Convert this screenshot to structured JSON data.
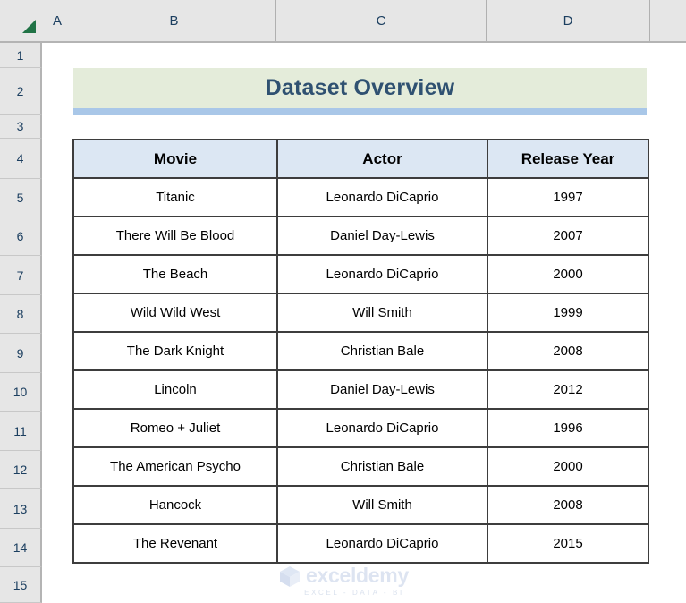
{
  "spreadsheet": {
    "select_all_icon": "select-all-triangle",
    "column_headers": [
      "A",
      "B",
      "C",
      "D"
    ],
    "row_headers": [
      "1",
      "2",
      "3",
      "4",
      "5",
      "6",
      "7",
      "8",
      "9",
      "10",
      "11",
      "12",
      "13",
      "14",
      "15"
    ]
  },
  "title_banner": {
    "text": "Dataset Overview",
    "background_color": "#e4ecda",
    "text_color": "#2f5171",
    "underline_color": "#a9c7e8"
  },
  "table": {
    "header_background": "#dce7f3",
    "border_color": "#3d3d3d",
    "columns": [
      "Movie",
      "Actor",
      "Release Year"
    ],
    "rows": [
      {
        "movie": "Titanic",
        "actor": "Leonardo DiCaprio",
        "year": "1997"
      },
      {
        "movie": "There Will Be Blood",
        "actor": "Daniel Day-Lewis",
        "year": "2007"
      },
      {
        "movie": "The Beach",
        "actor": "Leonardo DiCaprio",
        "year": "2000"
      },
      {
        "movie": "Wild Wild West",
        "actor": "Will Smith",
        "year": "1999"
      },
      {
        "movie": "The Dark Knight",
        "actor": "Christian Bale",
        "year": "2008"
      },
      {
        "movie": "Lincoln",
        "actor": "Daniel Day-Lewis",
        "year": "2012"
      },
      {
        "movie": "Romeo + Juliet",
        "actor": "Leonardo DiCaprio",
        "year": "1996"
      },
      {
        "movie": "The American Psycho",
        "actor": "Christian Bale",
        "year": "2000"
      },
      {
        "movie": "Hancock",
        "actor": "Will Smith",
        "year": "2008"
      },
      {
        "movie": "The Revenant",
        "actor": "Leonardo DiCaprio",
        "year": "2015"
      }
    ]
  },
  "watermark": {
    "name": "exceldemy",
    "tagline": "EXCEL - DATA - BI",
    "icon": "cube-logo-icon"
  }
}
